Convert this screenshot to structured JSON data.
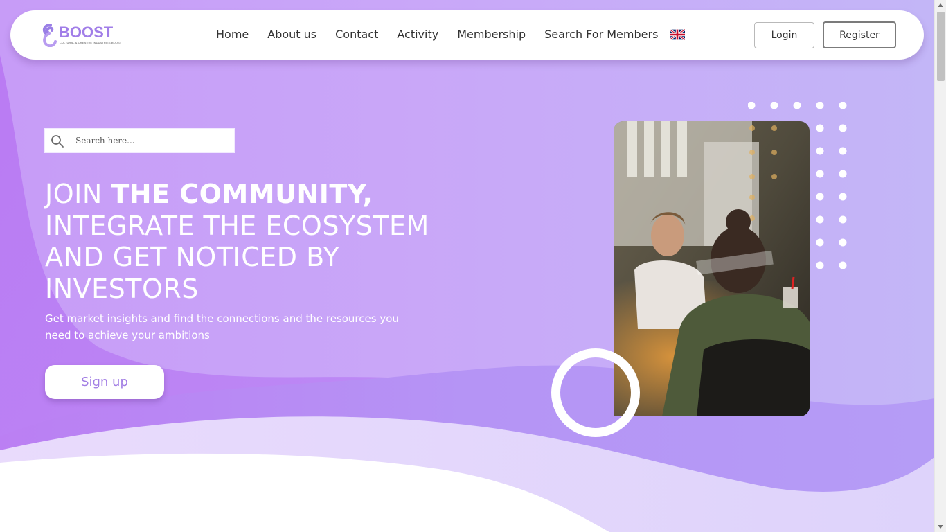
{
  "brand": {
    "name": "BOOST",
    "tagline": "CULTURAL & CREATIVE INDUSTRIES BOOST",
    "colors": {
      "primary": "#a17ee8",
      "hero_bg": "#c9a7f8",
      "white": "#ffffff"
    }
  },
  "nav": {
    "items": [
      {
        "label": "Home"
      },
      {
        "label": "About us"
      },
      {
        "label": "Contact"
      },
      {
        "label": "Activity"
      },
      {
        "label": "Membership"
      },
      {
        "label": "Search For Members"
      }
    ],
    "language_icon": "uk-flag-icon",
    "login_label": "Login",
    "register_label": "Register"
  },
  "search": {
    "placeholder": "Search here...",
    "value": "",
    "icon": "search-icon"
  },
  "hero": {
    "title_part1": "JOIN ",
    "title_bold": "THE COMMUNITY,",
    "title_part2": "INTEGRATE THE ECOSYSTEM AND GET NOTICED BY INVESTORS",
    "subtitle": "Get market insights and find the connections and the resources you need to achieve your ambitions",
    "cta_label": "Sign up"
  }
}
